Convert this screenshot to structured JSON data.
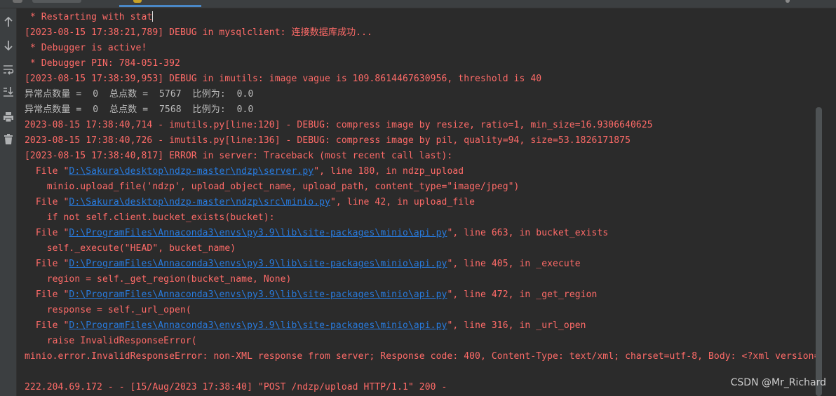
{
  "icons": [
    "scroll-up-icon",
    "scroll-down-icon",
    "soft-wrap-icon",
    "scroll-to-end-icon",
    "print-icon",
    "clear-all-icon"
  ],
  "colors": {
    "background": "#2b2b2b",
    "stderr": "#ff6b68",
    "stdout": "#bbbbbb",
    "link": "#287bde"
  },
  "console": {
    "l01": " * Restarting with stat",
    "l02": "[2023-08-15 17:38:21,789] DEBUG in mysqlclient: 连接数据库成功...",
    "l03": " * Debugger is active!",
    "l04": " * Debugger PIN: 784-051-392",
    "l05": "[2023-08-15 17:38:39,953] DEBUG in imutils: image vague is 109.8614467630956, threshold is 40",
    "l06": "异常点数量 =  0  总点数 =  5767  比例为:  0.0",
    "l07": "异常点数量 =  0  总点数 =  7568  比例为:  0.0",
    "l08": "2023-08-15 17:38:40,714 - imutils.py[line:120] - DEBUG: compress image by resize, ratio=1, min_size=16.9306640625",
    "l09": "2023-08-15 17:38:40,726 - imutils.py[line:136] - DEBUG: compress image by pil, quality=94, size=53.1826171875",
    "l10": "[2023-08-15 17:38:40,817] ERROR in server: Traceback (most recent call last):",
    "l11a": "  File \"",
    "l11b": "D:\\Sakura\\desktop\\ndzp-master\\ndzp\\server.py",
    "l11c": "\", line 180, in ndzp_upload",
    "l12": "    minio.upload_file('ndzp', upload_object_name, upload_path, content_type=\"image/jpeg\")",
    "l13a": "  File \"",
    "l13b": "D:\\Sakura\\desktop\\ndzp-master\\ndzp\\src\\minio.py",
    "l13c": "\", line 42, in upload_file",
    "l14": "    if not self.client.bucket_exists(bucket):",
    "l15a": "  File \"",
    "l15b": "D:\\ProgramFiles\\Annaconda3\\envs\\py3.9\\lib\\site-packages\\minio\\api.py",
    "l15c": "\", line 663, in bucket_exists",
    "l16": "    self._execute(\"HEAD\", bucket_name)",
    "l17a": "  File \"",
    "l17b": "D:\\ProgramFiles\\Annaconda3\\envs\\py3.9\\lib\\site-packages\\minio\\api.py",
    "l17c": "\", line 405, in _execute",
    "l18": "    region = self._get_region(bucket_name, None)",
    "l19a": "  File \"",
    "l19b": "D:\\ProgramFiles\\Annaconda3\\envs\\py3.9\\lib\\site-packages\\minio\\api.py",
    "l19c": "\", line 472, in _get_region",
    "l20": "    response = self._url_open(",
    "l21a": "  File \"",
    "l21b": "D:\\ProgramFiles\\Annaconda3\\envs\\py3.9\\lib\\site-packages\\minio\\api.py",
    "l21c": "\", line 316, in _url_open",
    "l22": "    raise InvalidResponseError(",
    "l23": "minio.error.InvalidResponseError: non-XML response from server; Response code: 400, Content-Type: text/xml; charset=utf-8, Body: <?xml version=",
    "l24": "",
    "l25": "222.204.69.172 - - [15/Aug/2023 17:38:40] \"POST /ndzp/upload HTTP/1.1\" 200 -"
  },
  "watermark": "CSDN @Mr_Richard"
}
